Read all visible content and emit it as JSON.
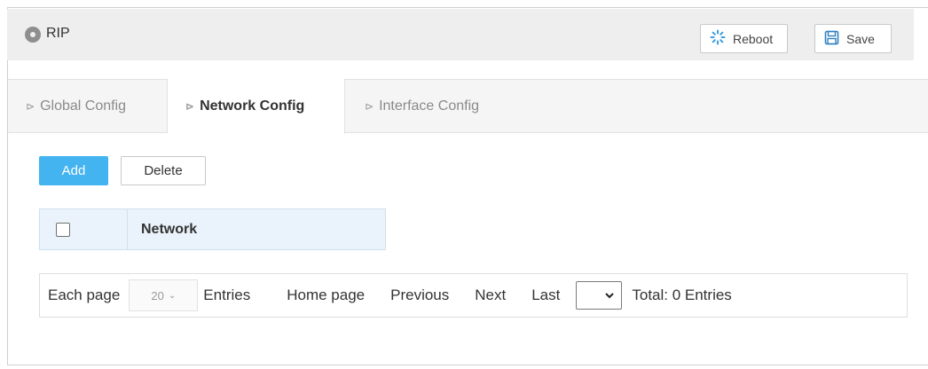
{
  "title": "RIP",
  "toolbar": {
    "reboot_label": "Reboot",
    "save_label": "Save",
    "reboot_icon": "spinner-icon",
    "save_icon": "floppy-disk-icon",
    "reboot_icon_color": "#3a9ee0",
    "save_icon_color": "#2f7fc1"
  },
  "tabs": [
    {
      "label": "Global Config",
      "active": false
    },
    {
      "label": "Network Config",
      "active": true
    },
    {
      "label": "Interface Config",
      "active": false
    }
  ],
  "actions": {
    "add_label": "Add",
    "delete_label": "Delete",
    "add_color": "#44b4f1"
  },
  "table": {
    "columns": [
      "Network"
    ],
    "rows": []
  },
  "pager": {
    "each_page_label": "Each page",
    "page_size": "20",
    "entries_label": "Entries",
    "home_label": "Home page",
    "previous_label": "Previous",
    "next_label": "Next",
    "last_label": "Last",
    "current_page": "",
    "total_label": "Total: 0 Entries"
  }
}
